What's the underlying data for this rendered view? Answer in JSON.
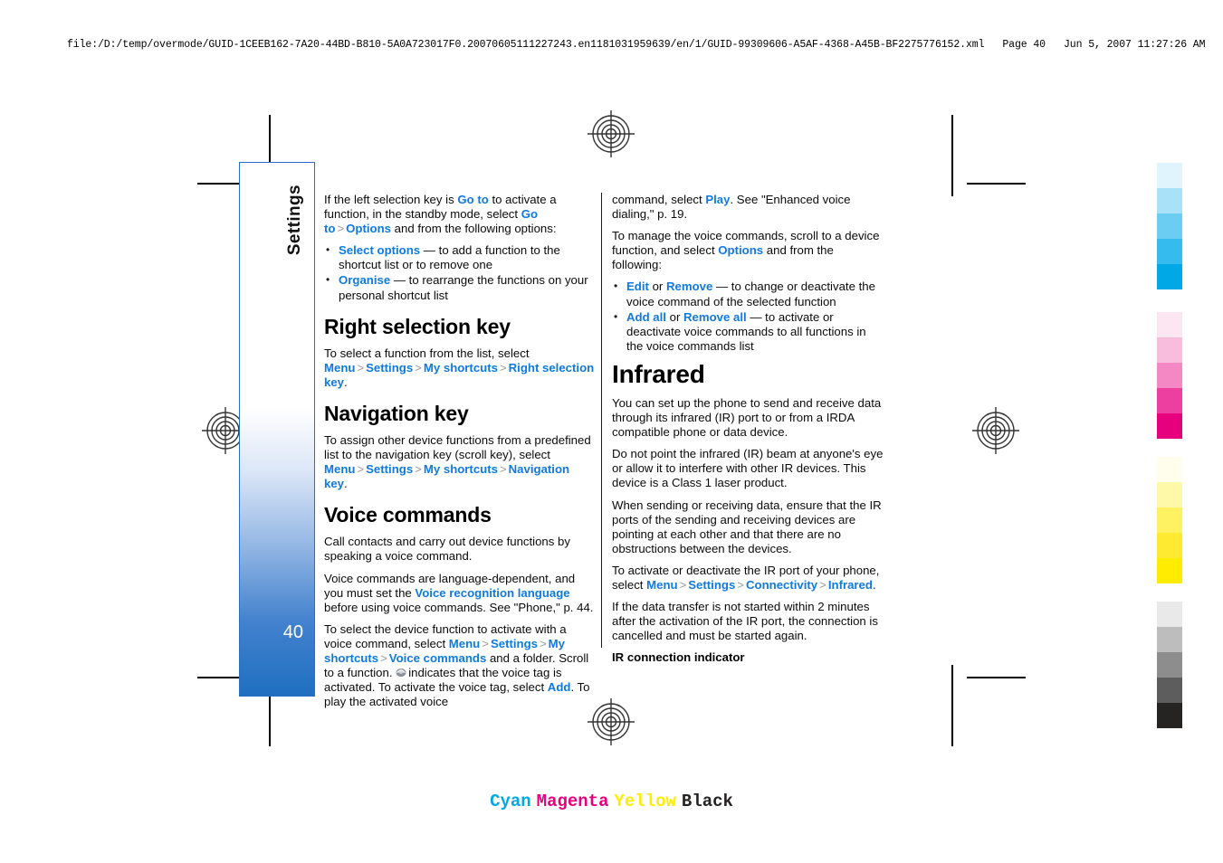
{
  "print_header": {
    "file_path": "file:/D:/temp/overmode/GUID-1CEEB162-7A20-44BD-B810-5A0A723017F0.20070605111227243.en1181031959639/en/1/GUID-99309606-A5AF-4368-A45B-BF2275776152.xml",
    "page_label": "Page 40",
    "timestamp": "Jun 5, 2007 11:27:26 AM"
  },
  "sidebar": {
    "chapter_label": "Settings",
    "page_number": "40"
  },
  "left_column": {
    "para_intro_1": "If the left selection key is ",
    "link_go_to_1": "Go to",
    "para_intro_2": " to activate a function, in the standby mode, select ",
    "link_go_to_2": "Go to",
    "link_options": "Options",
    "para_intro_3": " and from the following options:",
    "bullets": [
      {
        "link": "Select options",
        "text": " — to add a function to the shortcut list or to remove one"
      },
      {
        "link": "Organise",
        "text": " — to rearrange the functions on your personal shortcut list"
      }
    ],
    "heading_right_selection_key": "Right selection key",
    "rsk_text_1": "To select a function from the list, select ",
    "rsk_menu": "Menu",
    "rsk_settings": "Settings",
    "rsk_my_shortcuts": "My shortcuts",
    "rsk_right_selection_key": "Right selection key",
    "rsk_period": ".",
    "heading_navigation_key": "Navigation key",
    "nav_text_1": "To assign other device functions from a predefined list to the navigation key (scroll key), select ",
    "nav_menu": "Menu",
    "nav_settings": "Settings",
    "nav_my_shortcuts": "My shortcuts",
    "nav_navigation_key": "Navigation key",
    "nav_period": ".",
    "heading_voice_commands": "Voice commands",
    "vc_para_1": "Call contacts and carry out device functions by speaking a voice command.",
    "vc_para_2a": "Voice commands are language-dependent, and you must set the ",
    "vc_link_language": "Voice recognition language",
    "vc_para_2b": " before using voice commands. See \"Phone,\" p. 44.",
    "vc_para_3a": "To select the device function to activate with a voice command, select ",
    "vc_menu": "Menu",
    "vc_settings": "Settings",
    "vc_my_shortcuts": "My shortcuts",
    "vc_voice_commands": "Voice commands",
    "vc_para_3b": " and a folder. Scroll to a function. ",
    "vc_para_3c": "indicates that the voice tag is activated. To activate the voice tag, select ",
    "vc_link_add": "Add",
    "vc_para_3d": ". To play the activated voice"
  },
  "right_column": {
    "cont_para_1a": "command, select ",
    "cont_link_play": "Play",
    "cont_para_1b": ". See \"Enhanced voice dialing,\" p. 19.",
    "manage_para_a": "To manage the voice commands, scroll to a device function, and select ",
    "manage_link_options": "Options",
    "manage_para_b": " and from the following:",
    "bullets": [
      {
        "link_a": "Edit",
        "joiner": " or ",
        "link_b": "Remove",
        "text": " — to change or deactivate the voice command of the selected function"
      },
      {
        "link_a": "Add all",
        "joiner": " or ",
        "link_b": "Remove all",
        "text": " — to activate or deactivate voice commands to all functions in the voice commands list"
      }
    ],
    "heading_infrared": "Infrared",
    "ir_para_1": "You can set up the phone to send and receive data through its infrared (IR) port to or from a IRDA compatible phone or data device.",
    "ir_para_2": "Do not point the infrared (IR) beam at anyone's eye or allow it to interfere with other IR devices. This device is a Class 1 laser product.",
    "ir_para_3": "When sending or receiving data, ensure that the IR ports of the sending and receiving devices are pointing at each other and that there are no obstructions between the devices.",
    "ir_para_4a": "To activate or deactivate the IR port of your phone, select ",
    "ir_menu": "Menu",
    "ir_settings": "Settings",
    "ir_connectivity": "Connectivity",
    "ir_infrared": "Infrared",
    "ir_period": ".",
    "ir_para_5": "If the data transfer is not started within 2 minutes after the activation of the IR port, the connection is cancelled and must be started again.",
    "heading_ir_indicator": "IR connection indicator"
  },
  "separator": ">",
  "color_bars": {
    "cyan": [
      "#e0f4fd",
      "#a9e1f8",
      "#6ccdf3",
      "#35bbee",
      "#00a8e6"
    ],
    "magenta": [
      "#fce6f2",
      "#f8bcdc",
      "#f488c4",
      "#ed3fa0",
      "#e6007e"
    ],
    "yellow": [
      "#fffdeb",
      "#fef9a8",
      "#fef263",
      "#feeb31",
      "#ffec00"
    ],
    "black": [
      "#e9e9e9",
      "#bdbdbd",
      "#8d8d8d",
      "#5d5d5d",
      "#262323"
    ]
  },
  "cmyk_words": [
    {
      "label": "Cyan",
      "color": "#00a8e6"
    },
    {
      "label": "Magenta",
      "color": "#e6007e"
    },
    {
      "label": "Yellow",
      "color": "#ffec00"
    },
    {
      "label": "Black",
      "color": "#262323"
    }
  ]
}
